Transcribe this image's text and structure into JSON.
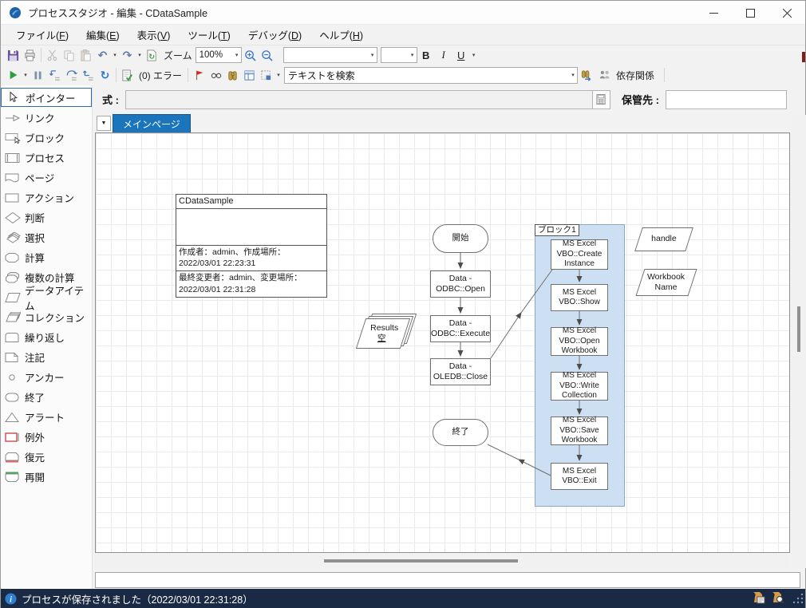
{
  "window": {
    "title": "プロセススタジオ - 編集 - CDataSample"
  },
  "menu": {
    "items": [
      {
        "label": "ファイル(F)"
      },
      {
        "label": "編集(E)"
      },
      {
        "label": "表示(V)"
      },
      {
        "label": "ツール(T)"
      },
      {
        "label": "デバッグ(D)"
      },
      {
        "label": "ヘルプ(H)"
      }
    ]
  },
  "toolbar_format": {
    "zoom_label": "ズーム",
    "zoom_value": "100%",
    "bold": "B",
    "italic": "I",
    "underline": "U",
    "font_name": "",
    "font_size": ""
  },
  "toolbar_debug": {
    "error_label": "(0) エラー",
    "search_value": "テキストを検索",
    "dependencies_label": "依存関係"
  },
  "expression_bar": {
    "label": "式 :",
    "value": "",
    "store_label": "保管先 :",
    "store_value": ""
  },
  "sidebar": {
    "items": [
      {
        "label": "ポインター"
      },
      {
        "label": "リンク"
      },
      {
        "label": "ブロック"
      },
      {
        "label": "プロセス"
      },
      {
        "label": "ページ"
      },
      {
        "label": "アクション"
      },
      {
        "label": "判断"
      },
      {
        "label": "選択"
      },
      {
        "label": "計算"
      },
      {
        "label": "複数の計算"
      },
      {
        "label": "データアイテム"
      },
      {
        "label": "コレクション"
      },
      {
        "label": "繰り返し"
      },
      {
        "label": "注記"
      },
      {
        "label": "アンカー"
      },
      {
        "label": "終了"
      },
      {
        "label": "アラート"
      },
      {
        "label": "例外"
      },
      {
        "label": "復元"
      },
      {
        "label": "再開"
      }
    ]
  },
  "page_tabs": {
    "selected": "メインページ"
  },
  "diagram": {
    "info_box": {
      "title": "CDataSample",
      "created": "作成者：admin、作成場所：\n2022/03/01 22:23:31",
      "modified": "最終変更者：admin、変更場所：\n2022/03/01 22:31:28"
    },
    "start": "開始",
    "odbc_open": "Data -\nODBC::Open",
    "odbc_execute": "Data -\nODBC::Execute",
    "oledb_close": "Data -\nOLEDB::Close",
    "results_title": "Results",
    "results_value": "空",
    "block_label": "ブロック1",
    "excel_create": "MS Excel\nVBO::Create\nInstance",
    "excel_show": "MS Excel\nVBO::Show",
    "excel_open_workbook": "MS Excel\nVBO::Open\nWorkbook",
    "excel_write_collection": "MS Excel\nVBO::Write\nCollection",
    "excel_save_workbook": "MS Excel\nVBO::Save\nWorkbook",
    "excel_exit": "MS Excel\nVBO::Exit",
    "handle": "handle",
    "workbook_name": "Workbook\nName",
    "end": "終了"
  },
  "status_bar": {
    "message": "プロセスが保存されました（2022/03/01 22:31:28）"
  },
  "icons": {
    "caret": "▾",
    "tab_caret": "▼",
    "undo": "↶",
    "redo": "↷",
    "restart": "↻",
    "refresh": "↻",
    "check": "✓",
    "info": "i"
  },
  "colors": {
    "accent_blue": "#1b75bc",
    "block_fill": "#cddff2",
    "status_bg": "#1b2a44",
    "grid_line": "#e7eaee",
    "run_green": "#2f9e3f",
    "save_purple": "#6b4f9e",
    "flag_red": "#d42a2a",
    "exception_red": "#c84b4b",
    "resume_green": "#4aa85a"
  }
}
